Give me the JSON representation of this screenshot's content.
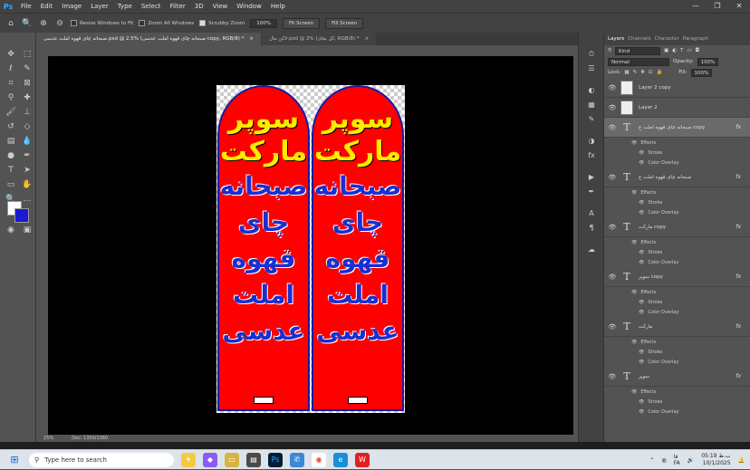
{
  "menubar": {
    "logo": "Ps",
    "items": [
      "File",
      "Edit",
      "Image",
      "Layer",
      "Type",
      "Select",
      "Filter",
      "3D",
      "View",
      "Window",
      "Help"
    ],
    "controls": [
      "—",
      "❐",
      "✕"
    ]
  },
  "options": {
    "resize_windows": "Resize Windows to Fit",
    "zoom_all": "Zoom All Windows",
    "scrubby_zoom": "Scrubby Zoom",
    "zoom_value": "100%",
    "fit_screen": "Fit Screen",
    "fill_screen": "Fill Screen"
  },
  "tabs": [
    {
      "label": "صبحانه چای قهوه املت عدسی.psd @ 2.5% (صبحانه چای قهوه املت عدسی copy, RGB/8) *",
      "close": "×"
    },
    {
      "label": "لاکن مال.psd @ 2% (کل یغای, RGB/8) *",
      "close": "×"
    }
  ],
  "flag": {
    "line1": "سوپر",
    "line2": "مارکت",
    "line3": "صبحانه",
    "line4": "چای",
    "line5": "قهوه",
    "line6": "املت",
    "line7": "عدسی"
  },
  "status": {
    "zoom": "25%",
    "doc": "Doc: 1350/1360"
  },
  "layers_panel": {
    "tabs": [
      "Layers",
      "Channels",
      "Character",
      "Paragraph"
    ],
    "kind_label": "Kind",
    "blend_mode": "Normal",
    "opacity_label": "Opacity:",
    "opacity_value": "100%",
    "lock_label": "Lock:",
    "fill_label": "Fill:",
    "fill_value": "100%",
    "layers": [
      {
        "name": "Layer 2 copy",
        "type": "image"
      },
      {
        "name": "Layer 2",
        "type": "image"
      },
      {
        "name": "صبحانه چای قهوه املت ع copy",
        "type": "text",
        "fx": "fx",
        "effects": [
          "Effects",
          "Stroke",
          "Color Overlay"
        ]
      },
      {
        "name": "صبحانه چای قهوه املت ع",
        "type": "text",
        "fx": "fx",
        "effects": [
          "Effects",
          "Stroke",
          "Color Overlay"
        ]
      },
      {
        "name": "مارکت copy",
        "type": "text",
        "fx": "fx",
        "effects": [
          "Effects",
          "Stroke",
          "Color Overlay"
        ]
      },
      {
        "name": "سوپر copy",
        "type": "text",
        "fx": "fx",
        "effects": [
          "Effects",
          "Stroke",
          "Color Overlay"
        ]
      },
      {
        "name": "مارکت",
        "type": "text",
        "fx": "fx",
        "effects": [
          "Effects",
          "Stroke",
          "Color Overlay"
        ]
      },
      {
        "name": "سوپر",
        "type": "text",
        "fx": "fx",
        "effects": [
          "Effects",
          "Stroke",
          "Color Overlay"
        ]
      }
    ]
  },
  "taskbar": {
    "search_placeholder": "Type here to search",
    "time": "05:19 ب.ظ",
    "date": "10/1/2025",
    "lang": "FA",
    "lang2": "فا"
  },
  "colors": {
    "flag_red": "#ff0000",
    "yellow_text": "#ffea00",
    "blue_text": "#1a2fd0",
    "ps_bg": "#535353"
  }
}
